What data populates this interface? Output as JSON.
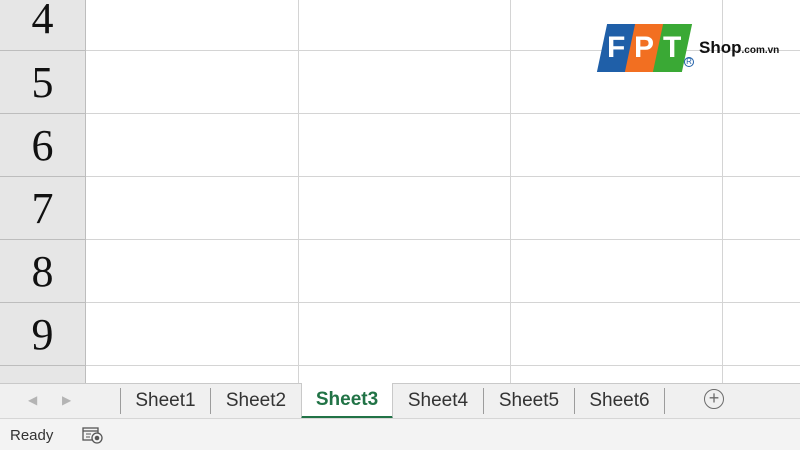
{
  "grid": {
    "row_numbers": [
      "4",
      "5",
      "6",
      "7",
      "8",
      "9"
    ]
  },
  "watermark": {
    "brand_letters": [
      "F",
      "P",
      "T"
    ],
    "brand_colors": [
      "#1f5fa8",
      "#f26f21",
      "#3aa935"
    ],
    "shop_text": "Shop",
    "domain_text": ".com.vn",
    "registered_mark": "R"
  },
  "sheet_tabs": {
    "prev_arrow": "◀",
    "next_arrow": "▶",
    "tabs": [
      {
        "label": "Sheet1"
      },
      {
        "label": "Sheet2"
      },
      {
        "label": "Sheet3",
        "active": true
      },
      {
        "label": "Sheet4"
      },
      {
        "label": "Sheet5"
      },
      {
        "label": "Sheet6"
      }
    ],
    "add_sheet_symbol": "+",
    "active_color": "#217346"
  },
  "status_bar": {
    "status": "Ready",
    "macro_icon": "macro-recording-icon"
  }
}
